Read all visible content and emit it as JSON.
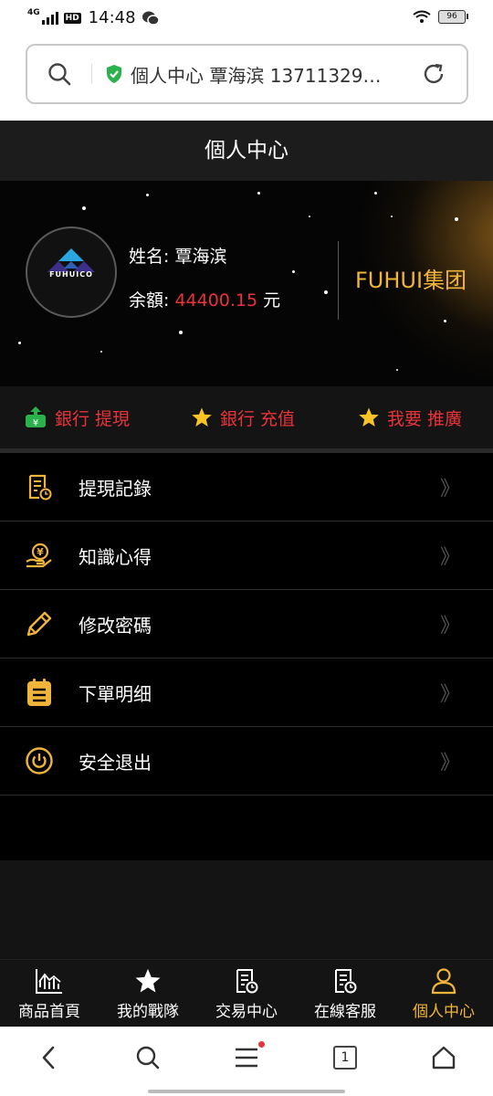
{
  "status_bar": {
    "network": "4G",
    "hd": "HD",
    "time": "14:48",
    "battery": "96"
  },
  "browser": {
    "url_text": "個人中心 覃海滨 13711329…"
  },
  "page_title": "個人中心",
  "profile": {
    "logo_text": "FUHUICO",
    "name_label": "姓名:",
    "name_value": "覃海滨",
    "balance_label": "余額:",
    "balance_value": "44400.15",
    "balance_unit": "元",
    "brand": "FUHUI集团"
  },
  "actions": [
    {
      "label": "銀行 提現",
      "icon": "bank-withdraw-icon"
    },
    {
      "label": "銀行 充值",
      "icon": "star-icon"
    },
    {
      "label": "我要 推廣",
      "icon": "star-icon"
    }
  ],
  "menu": [
    {
      "label": "提現記錄",
      "icon": "document-clock-icon"
    },
    {
      "label": "知識心得",
      "icon": "hand-money-icon"
    },
    {
      "label": "修改密碼",
      "icon": "pencil-icon"
    },
    {
      "label": "下單明细",
      "icon": "clipboard-list-icon"
    },
    {
      "label": "安全退出",
      "icon": "power-icon"
    }
  ],
  "menu_chevron": "》",
  "tabs": [
    {
      "label": "商品首頁",
      "icon": "chart-icon",
      "active": false
    },
    {
      "label": "我的戰隊",
      "icon": "star-icon",
      "active": false
    },
    {
      "label": "交易中心",
      "icon": "document-clock-icon",
      "active": false
    },
    {
      "label": "在線客服",
      "icon": "document-clock-icon",
      "active": false
    },
    {
      "label": "個人中心",
      "icon": "user-icon",
      "active": true
    }
  ],
  "browser_nav": {
    "tab_count": "1"
  },
  "colors": {
    "accent_gold": "#f0b43a",
    "accent_red": "#e8333a",
    "safe_green": "#2bb24c"
  }
}
